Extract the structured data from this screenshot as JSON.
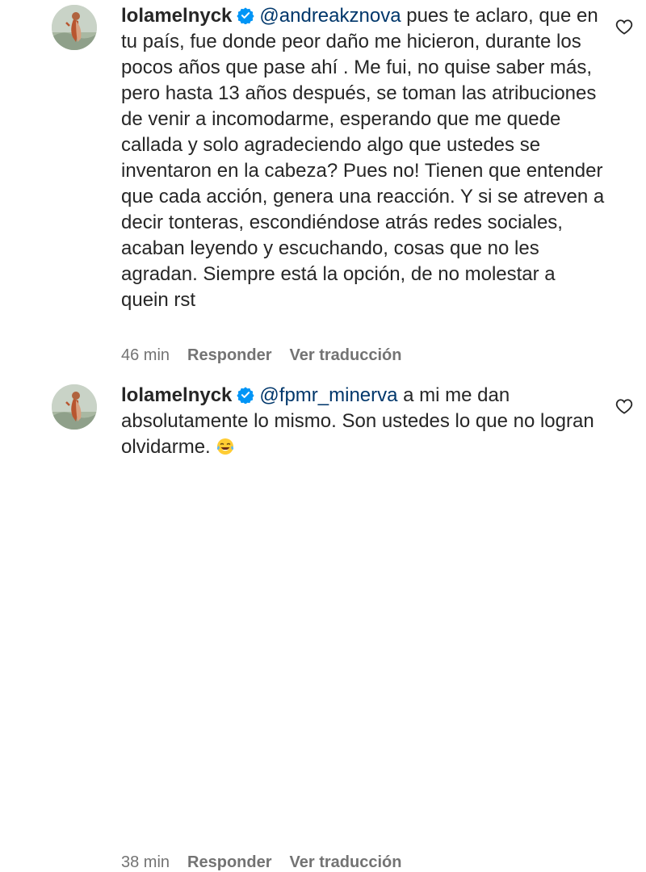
{
  "comments": [
    {
      "username": "lolamelnyck",
      "mention": "@andreakznova",
      "text": " pues te aclaro, que en tu país, fue donde peor daño me hicieron, durante los pocos años que pase ahí . Me fui, no quise saber más, pero hasta 13 años después, se toman las atribuciones de venir a incomodarme, esperando que me quede callada y solo agradeciendo algo que ustedes se inventaron en la cabeza? Pues no! Tienen que entender que cada acción, genera una reacción. Y si se atreven a decir tonteras, escondiéndose atrás redes sociales, acaban leyendo y escuchando, cosas que no les agradan. Siempre está la opción, de no molestar a quein rst",
      "time": "46 min",
      "reply_label": "Responder",
      "translate_label": "Ver traducción"
    },
    {
      "username": "lolamelnyck",
      "mention": "@fpmr_minerva",
      "text": " a mi me dan absolutamente lo mismo. Son ustedes lo que no logran olvidarme. ",
      "time": "38 min",
      "reply_label": "Responder",
      "translate_label": "Ver traducción"
    }
  ],
  "colors": {
    "text": "#262626",
    "mention": "#00376b",
    "meta": "#737373",
    "verified": "#0095f6"
  },
  "icons": {
    "verified": "verified-badge-icon",
    "like": "heart-outline-icon",
    "emoji": "face-with-tears-of-joy-icon"
  }
}
